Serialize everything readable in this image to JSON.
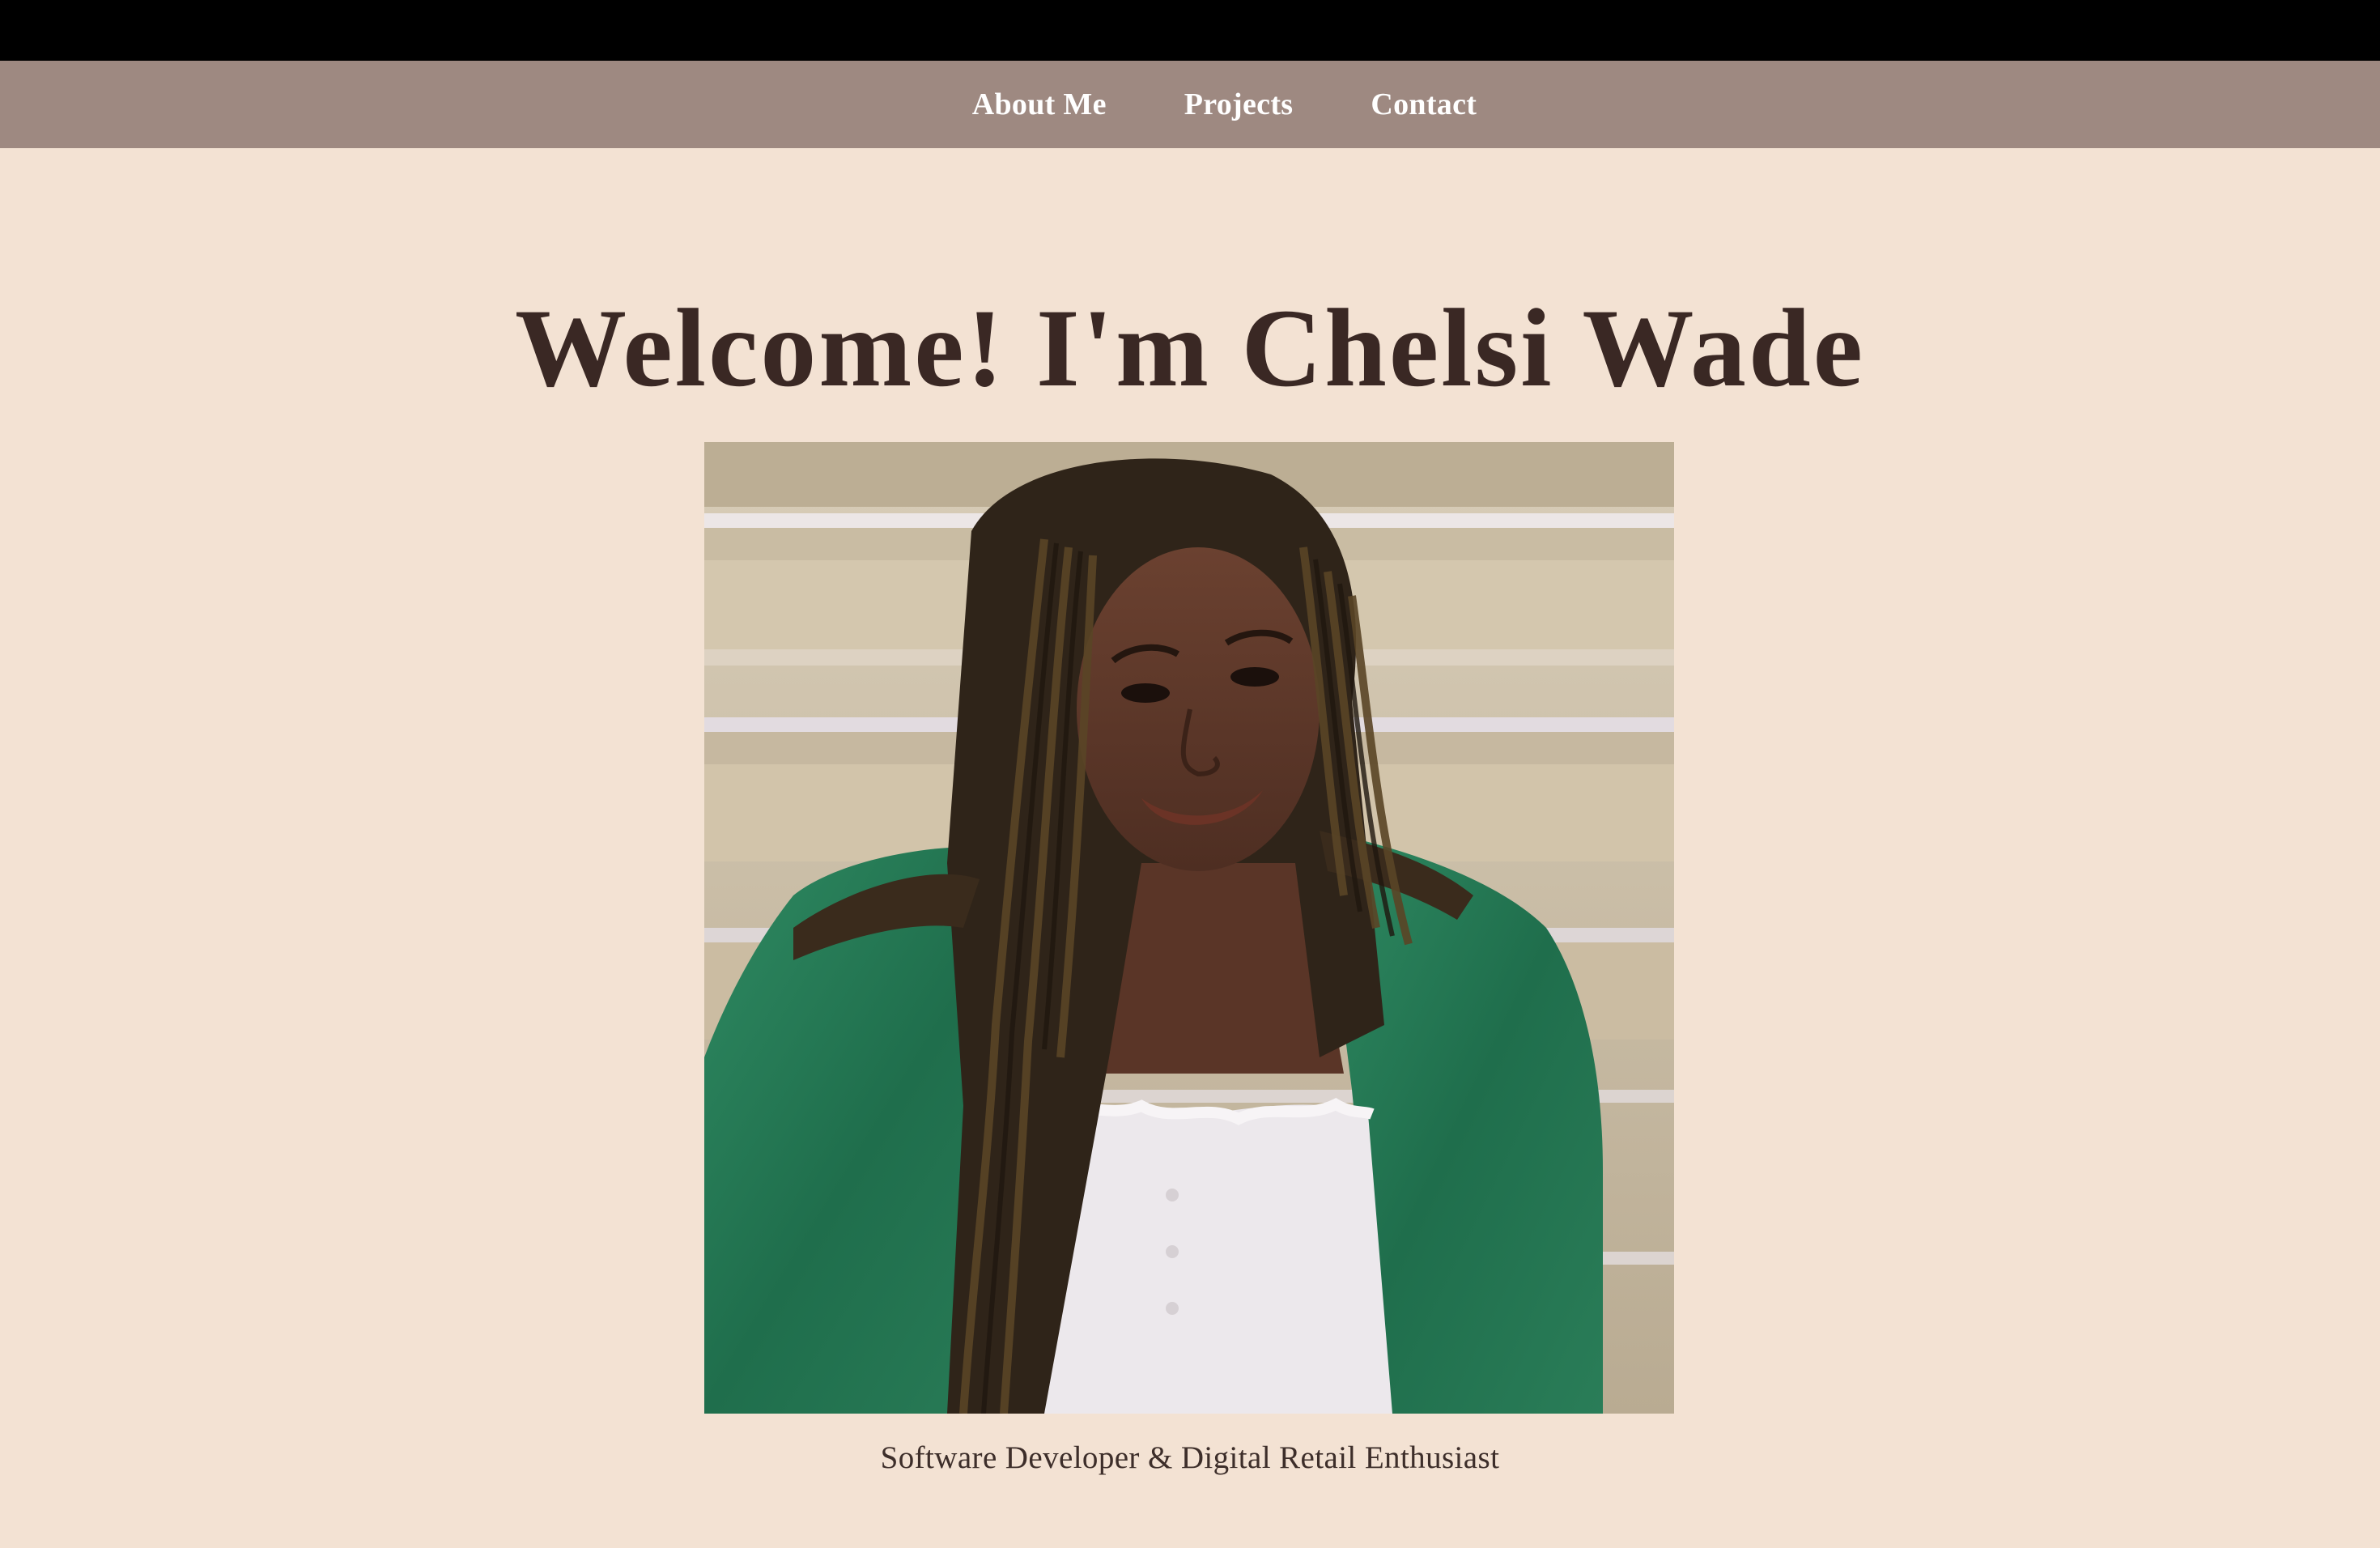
{
  "nav": {
    "items": [
      {
        "label": "About Me"
      },
      {
        "label": "Projects"
      },
      {
        "label": "Contact"
      }
    ]
  },
  "hero": {
    "title": "Welcome! I'm Chelsi Wade",
    "tagline": "Software Developer & Digital Retail Enthusiast"
  },
  "colors": {
    "page_background": "#f3e2d3",
    "nav_background": "#9e8981",
    "top_bar": "#000000",
    "title_text": "#3a2824",
    "nav_text": "#ffffff"
  }
}
